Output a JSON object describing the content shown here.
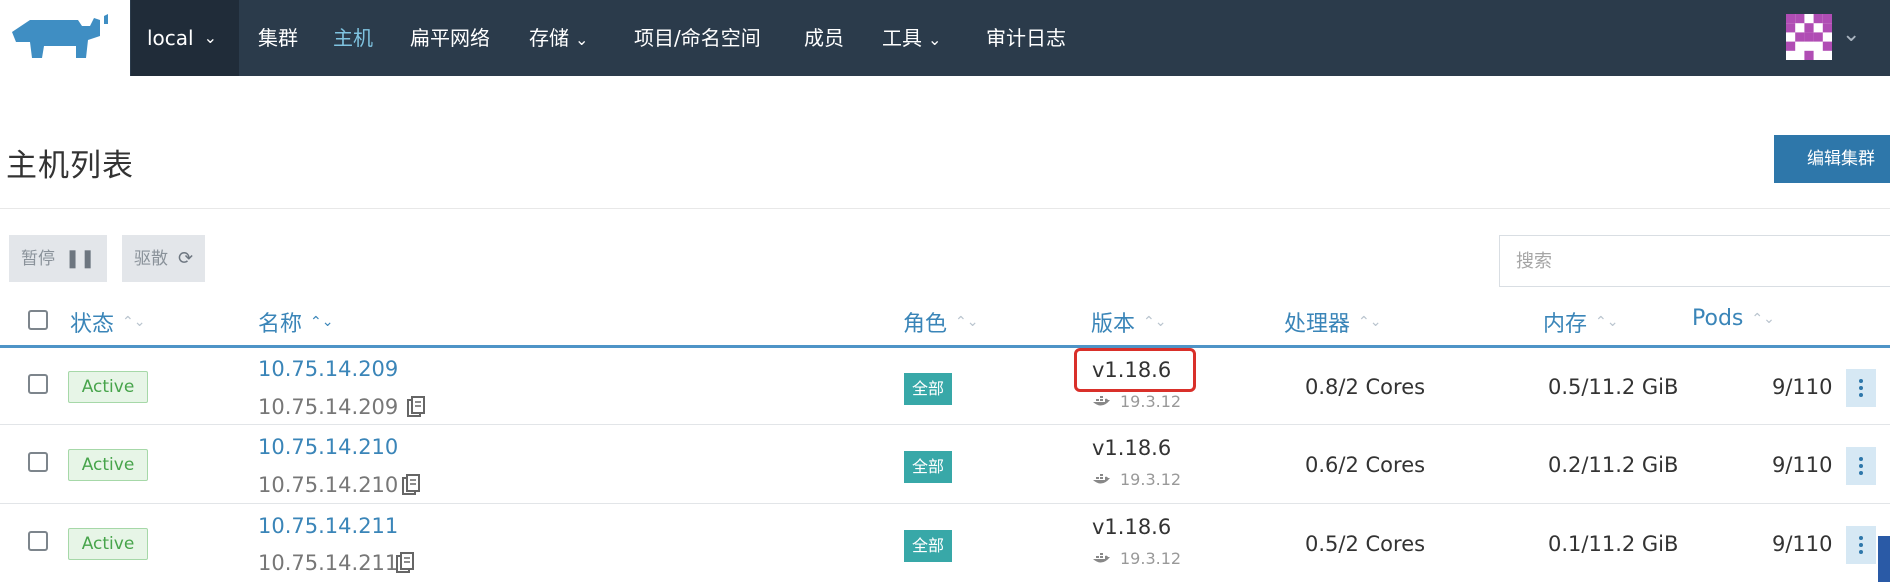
{
  "nav": {
    "cluster": "local",
    "items": [
      {
        "label": "集群",
        "active": false,
        "dropdown": false
      },
      {
        "label": "主机",
        "active": true,
        "dropdown": false
      },
      {
        "label": "扁平网络",
        "active": false,
        "dropdown": false
      },
      {
        "label": "存储",
        "active": false,
        "dropdown": true
      },
      {
        "label": "项目/命名空间",
        "active": false,
        "dropdown": false
      },
      {
        "label": "成员",
        "active": false,
        "dropdown": false
      },
      {
        "label": "工具",
        "active": false,
        "dropdown": true
      },
      {
        "label": "审计日志",
        "active": false,
        "dropdown": false
      }
    ],
    "chevron": "⌄"
  },
  "header": {
    "title": "主机列表",
    "edit_button": "编辑集群"
  },
  "actions": {
    "pause": "暂停",
    "drain": "驱散",
    "search_placeholder": "搜索"
  },
  "table": {
    "columns": [
      "状态",
      "名称",
      "角色",
      "版本",
      "处理器",
      "内存",
      "Pods"
    ],
    "rows": [
      {
        "state": "Active",
        "name": "10.75.14.209",
        "address": "10.75.14.209",
        "role": "全部",
        "version": "v1.18.6",
        "docker": "19.3.12",
        "cpu": "0.8/2 Cores",
        "memory": "0.5/11.2 GiB",
        "pods": "9/110"
      },
      {
        "state": "Active",
        "name": "10.75.14.210",
        "address": "10.75.14.210",
        "role": "全部",
        "version": "v1.18.6",
        "docker": "19.3.12",
        "cpu": "0.6/2 Cores",
        "memory": "0.2/11.2 GiB",
        "pods": "9/110"
      },
      {
        "state": "Active",
        "name": "10.75.14.211",
        "address": "10.75.14.211",
        "role": "全部",
        "version": "v1.18.6",
        "docker": "19.3.12",
        "cpu": "0.5/2 Cores",
        "memory": "0.1/11.2 GiB",
        "pods": "9/110"
      }
    ]
  },
  "colors": {
    "nav_bg": "#2b3b4b",
    "accent": "#3a85b8",
    "active_badge": "#47a44b",
    "role_badge": "#38a8a8",
    "highlight": "#d9302a"
  }
}
